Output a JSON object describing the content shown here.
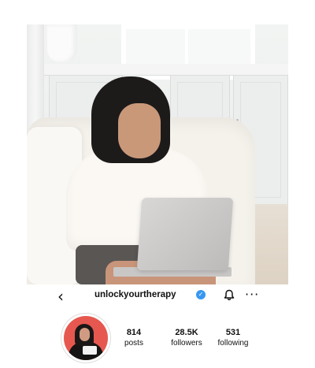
{
  "profile": {
    "username": "unlockyourtherapy",
    "verified": true,
    "stats": [
      {
        "value": "814",
        "label": "posts"
      },
      {
        "value": "28.5K",
        "label": "followers"
      },
      {
        "value": "531",
        "label": "following"
      }
    ]
  },
  "icons": {
    "back": "chevron-left-icon",
    "verified": "verified-badge-icon",
    "notifications": "bell-icon",
    "more": "more-options-icon"
  },
  "colors": {
    "verified_badge": "#3897f0",
    "avatar_background": "#e6584f",
    "text": "#111111"
  }
}
